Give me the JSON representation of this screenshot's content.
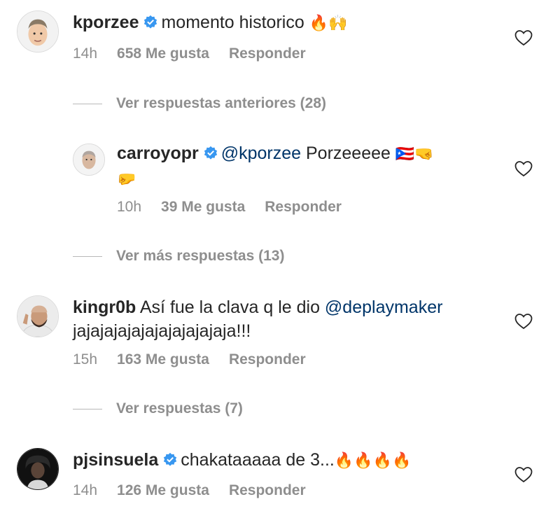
{
  "comments": [
    {
      "username": "kporzee",
      "text_before": "momento historico",
      "emojis": "🔥🙌",
      "time": "14h",
      "likes": "658 Me gusta",
      "reply": "Responder"
    },
    {
      "username": "carroyopr",
      "mention": "@kporzee",
      "text": "Porzeeeee",
      "emojis": "🇵🇷🤜",
      "emojis_line2": "🤛",
      "time": "10h",
      "likes": "39 Me gusta",
      "reply": "Responder"
    },
    {
      "username": "kingr0b",
      "text_before": "Así fue la clava q le dio",
      "mention": "@deplaymaker",
      "text_line2": "jajajajajajajajajajajaja!!!",
      "time": "15h",
      "likes": "163 Me gusta",
      "reply": "Responder"
    },
    {
      "username": "pjsinsuela",
      "text_before": "chakataaaaa de 3...",
      "emojis": "🔥🔥🔥🔥",
      "time": "14h",
      "likes": "126 Me gusta",
      "reply": "Responder"
    }
  ],
  "view_more": {
    "previous_replies": "Ver respuestas anteriores (28)",
    "more_replies": "Ver más respuestas (13)",
    "replies": "Ver respuestas (7)"
  },
  "colors": {
    "text": "#262626",
    "meta": "#8e8e8e",
    "mention": "#003569",
    "verified": "#3897f0"
  },
  "icons": {
    "verified": "verified-badge-icon",
    "like": "heart-outline-icon"
  }
}
